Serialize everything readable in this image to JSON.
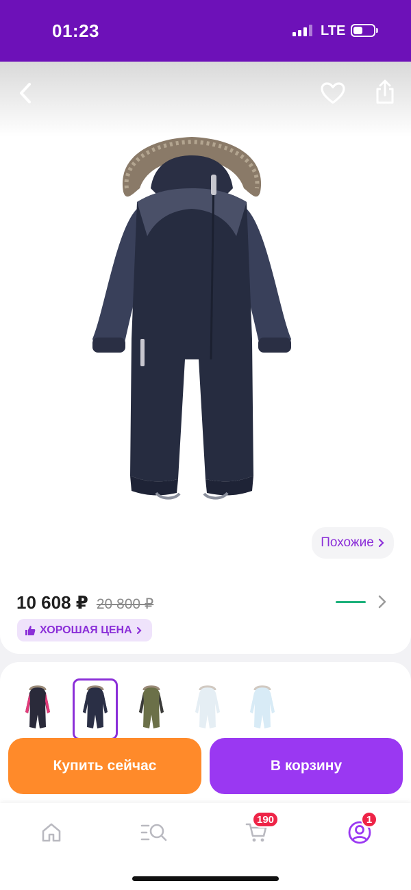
{
  "status_bar": {
    "time": "01:23",
    "network": "LTE",
    "background_color": "#6d11b8"
  },
  "product": {
    "image_icon": "snowsuit-image",
    "similar_label": "Похожие",
    "price_current": "10 608 ₽",
    "price_old": "20 800 ₽",
    "price_badge": "ХОРОШАЯ ЦЕНА",
    "badge_icon": "thumbs-up-icon"
  },
  "header_icons": {
    "back": "chevron-left-icon",
    "favorite": "heart-icon",
    "share": "share-icon"
  },
  "variants": [
    {
      "name": "pink-navy",
      "color": "#2a2a3a",
      "accent": "#e33a7a",
      "selected": false
    },
    {
      "name": "navy",
      "color": "#2a2f45",
      "accent": "#2a2f45",
      "selected": true
    },
    {
      "name": "khaki",
      "color": "#6b7048",
      "accent": "#3a3a3a",
      "selected": false
    },
    {
      "name": "light-blue",
      "color": "#c7dbe8",
      "accent": "#c7dbe8",
      "selected": false
    },
    {
      "name": "sky-blue",
      "color": "#a9d3ec",
      "accent": "#a9d3ec",
      "selected": false
    }
  ],
  "actions": {
    "buy_now": "Купить сейчас",
    "add_to_cart": "В корзину",
    "buy_color": "#ff8a2a",
    "cart_color": "#9a38f2"
  },
  "tab_bar": {
    "cart_count": "190",
    "profile_count": "1",
    "icons": [
      "home-icon",
      "catalog-search-icon",
      "cart-icon",
      "profile-icon"
    ]
  }
}
